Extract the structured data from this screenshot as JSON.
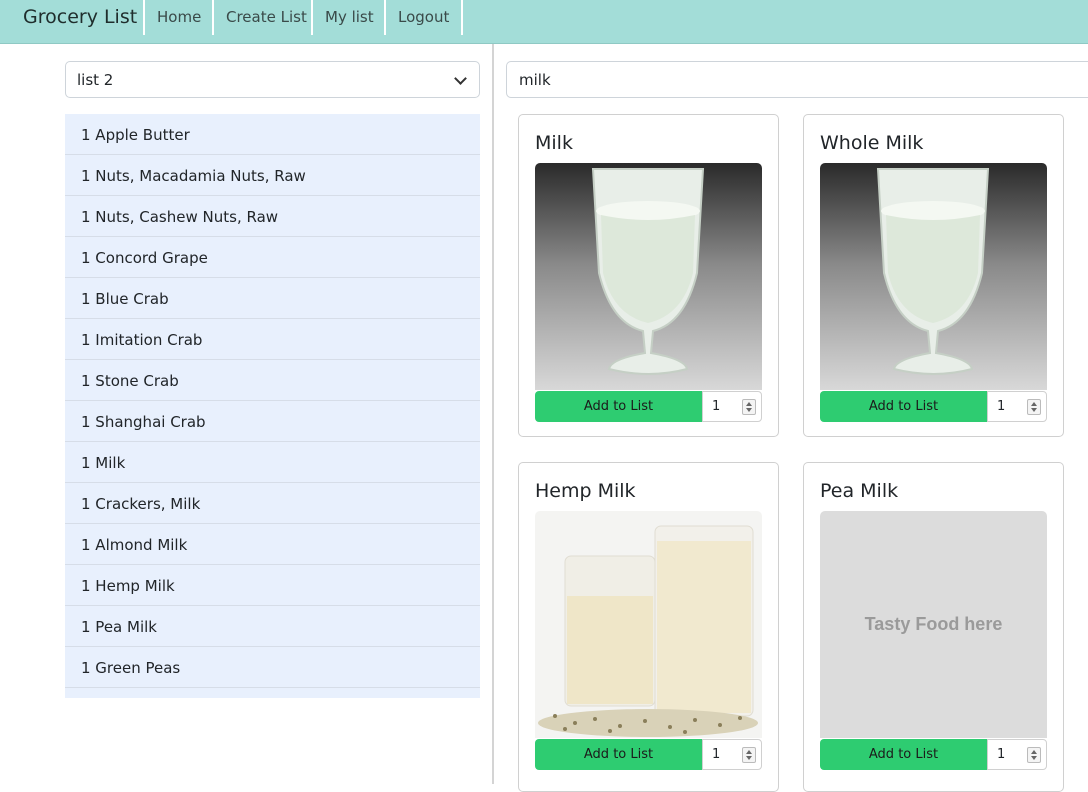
{
  "navbar": {
    "brand": "Grocery List",
    "items": [
      {
        "label": "Home"
      },
      {
        "label": "Create List"
      },
      {
        "label": "My list"
      },
      {
        "label": "Logout"
      }
    ],
    "color": "#a3ddd8"
  },
  "list_select": {
    "value": "list 2"
  },
  "list_items": [
    "1 Apple Butter",
    "1 Nuts, Macadamia Nuts, Raw",
    "1 Nuts, Cashew Nuts, Raw",
    "1 Concord Grape",
    "1 Blue Crab",
    "1 Imitation Crab",
    "1 Stone Crab",
    "1 Shanghai Crab",
    "1 Milk",
    "1 Crackers, Milk",
    "1 Almond Milk",
    "1 Hemp Milk",
    "1 Pea Milk",
    "1 Green Peas"
  ],
  "search": {
    "value": "milk"
  },
  "cards": [
    {
      "title": "Milk",
      "button": "Add to List",
      "quantity": "1",
      "image": "milk-glass"
    },
    {
      "title": "Whole Milk",
      "button": "Add to List",
      "quantity": "1",
      "image": "milk-glass"
    },
    {
      "title": "Hemp Milk",
      "button": "Add to List",
      "quantity": "1",
      "image": "hemp-milk-glasses"
    },
    {
      "title": "Pea Milk",
      "button": "Add to List",
      "quantity": "1",
      "image": "placeholder",
      "placeholder_text": "Tasty Food here"
    }
  ],
  "colors": {
    "button": "#2ecc71",
    "list_bg": "#e8f0fd"
  }
}
